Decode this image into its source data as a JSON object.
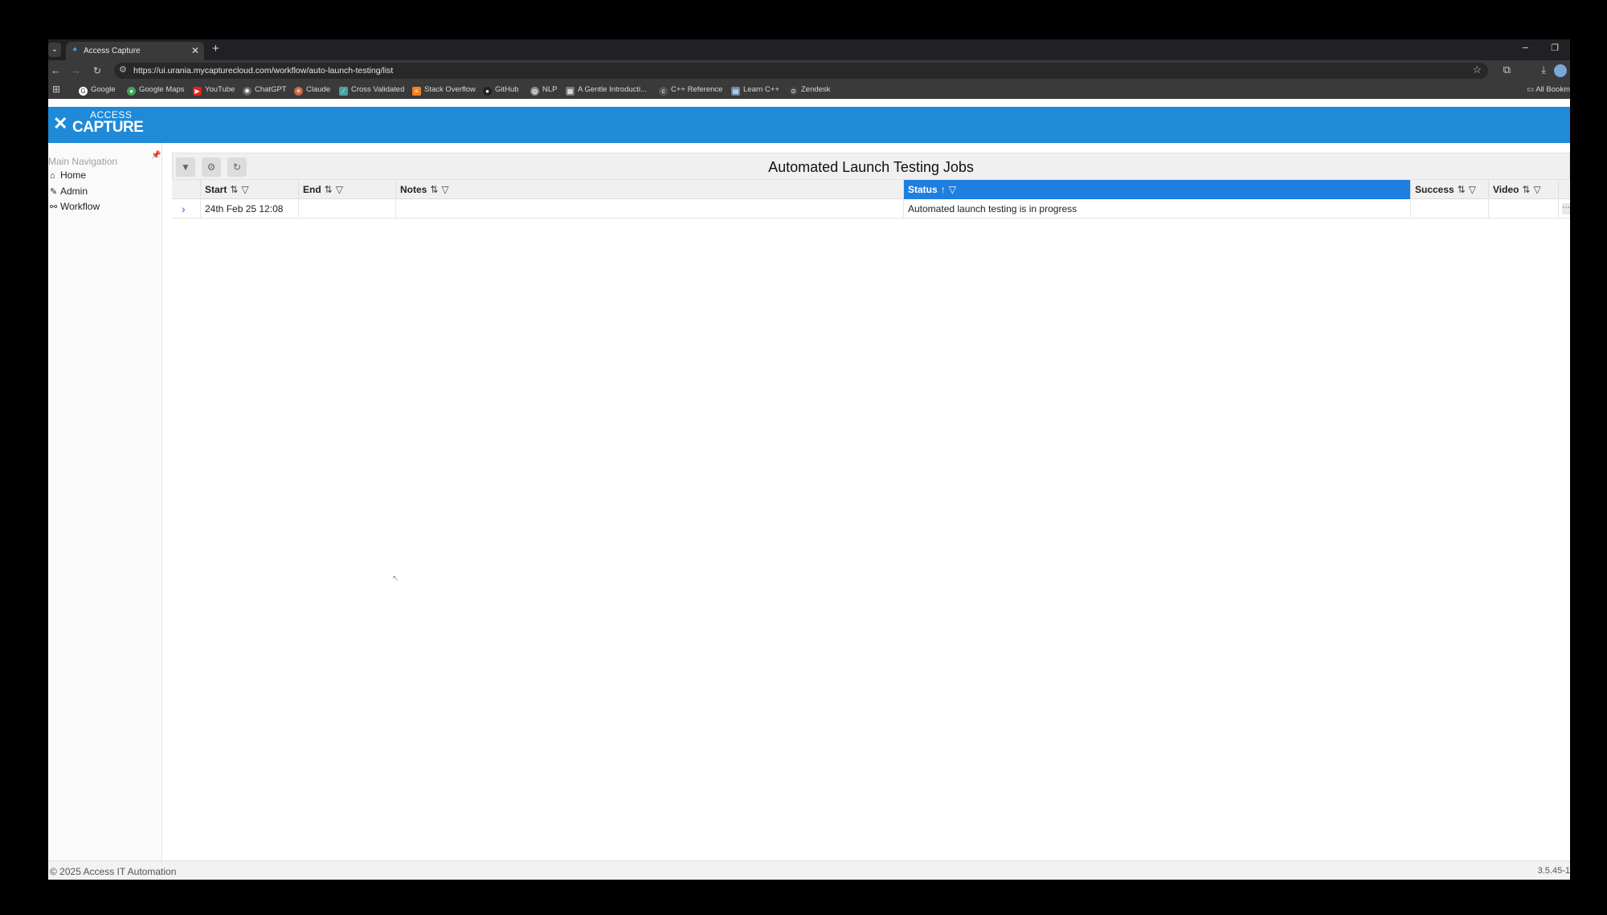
{
  "browser": {
    "tab_title": "Access Capture",
    "url": "https://ui.urania.mycapturecloud.com/workflow/auto-launch-testing/list",
    "bookmarks": [
      "Google",
      "Google Maps",
      "YouTube",
      "ChatGPT",
      "Claude",
      "Cross Validated",
      "Stack Overflow",
      "GitHub",
      "NLP",
      "A Gentle Introducti...",
      "C++ Reference",
      "Learn C++",
      "Zendesk"
    ],
    "all_bookmarks": "All Bookm"
  },
  "app": {
    "logo_line1": "ACCESS",
    "logo_line2": "CAPTURE",
    "colors": {
      "header": "#1e8ad8",
      "active_column": "#1e7fe0"
    }
  },
  "sidebar": {
    "title": "Main Navigation",
    "items": [
      {
        "label": "Home",
        "icon": "home-icon"
      },
      {
        "label": "Admin",
        "icon": "wrench-icon"
      },
      {
        "label": "Workflow",
        "icon": "workflow-icon"
      }
    ]
  },
  "main": {
    "title": "Automated Launch Testing Jobs",
    "columns": [
      "Start",
      "End",
      "Notes",
      "Status",
      "Success",
      "Video"
    ],
    "rows": [
      {
        "start": "24th Feb 25 12:08",
        "end": "",
        "notes": "",
        "status": "Automated launch testing is in progress",
        "success": "",
        "video": ""
      }
    ]
  },
  "footer": {
    "copyright": "© 2025 Access IT Automation",
    "version": "3.5.45-1"
  }
}
